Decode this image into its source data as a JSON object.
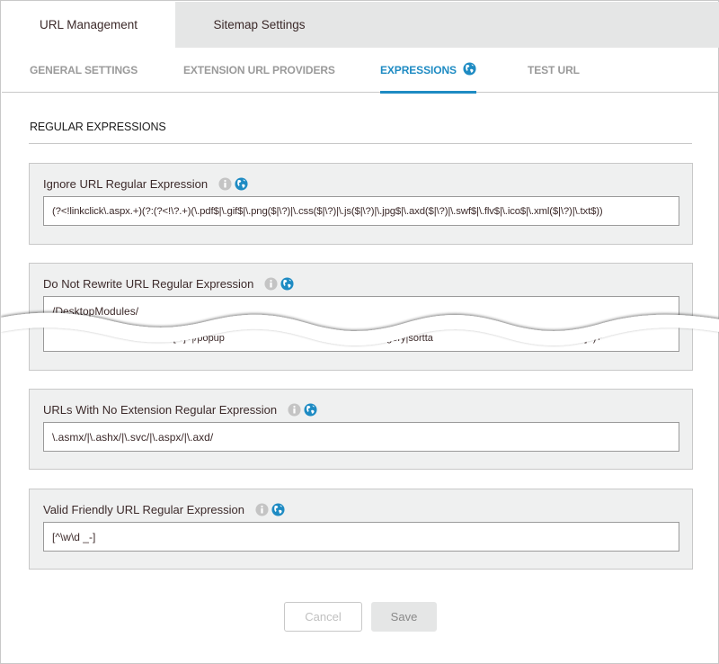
{
  "top_tabs": [
    {
      "label": "URL Management",
      "active": true
    },
    {
      "label": "Sitemap Settings",
      "active": false
    }
  ],
  "sub_tabs": [
    {
      "label": "GENERAL SETTINGS",
      "active": false
    },
    {
      "label": "EXTENSION URL PROVIDERS",
      "active": false
    },
    {
      "label": "EXPRESSIONS",
      "active": true,
      "icon": "globe-icon"
    },
    {
      "label": "TEST URL",
      "active": false
    }
  ],
  "section": {
    "title": "REGULAR EXPRESSIONS"
  },
  "fields": [
    {
      "label": "Ignore URL Regular Expression",
      "value": "(?<!linkclick\\.aspx.+)(?:(?<!\\?.+)(\\.pdf$|\\.gif$|\\.png($|\\?)|\\.css($|\\?)|\\.js($|\\?)|\\.jpg$|\\.axd($|\\?)|\\.swf$|\\.flv$|\\.ico$|\\.xml($|\\?)|\\.txt$))",
      "icons": [
        "info-icon",
        "globe-icon"
      ]
    },
    {
      "label": "Do Not Rewrite URL Regular Expression",
      "value": "/DesktopModules/",
      "value_fragments": [
        "-[^/]+|/popup",
        "egory|sortta",
        "[^/]+)+"
      ],
      "icons": [
        "info-icon",
        "globe-icon"
      ]
    },
    {
      "label": "URLs With No Extension Regular Expression",
      "value": "\\.asmx/|\\.ashx/|\\.svc/|\\.aspx/|\\.axd/",
      "icons": [
        "info-icon",
        "globe-icon"
      ]
    },
    {
      "label": "Valid Friendly URL Regular Expression",
      "value": "[^\\w\\d _-]",
      "icons": [
        "info-icon",
        "globe-icon"
      ]
    }
  ],
  "buttons": {
    "cancel": "Cancel",
    "save": "Save"
  },
  "colors": {
    "accent": "#1e8bc3",
    "panel_bg": "#eff0f0",
    "inactive_tab_bg": "#e5e6e6",
    "border": "#c8c8c8"
  }
}
